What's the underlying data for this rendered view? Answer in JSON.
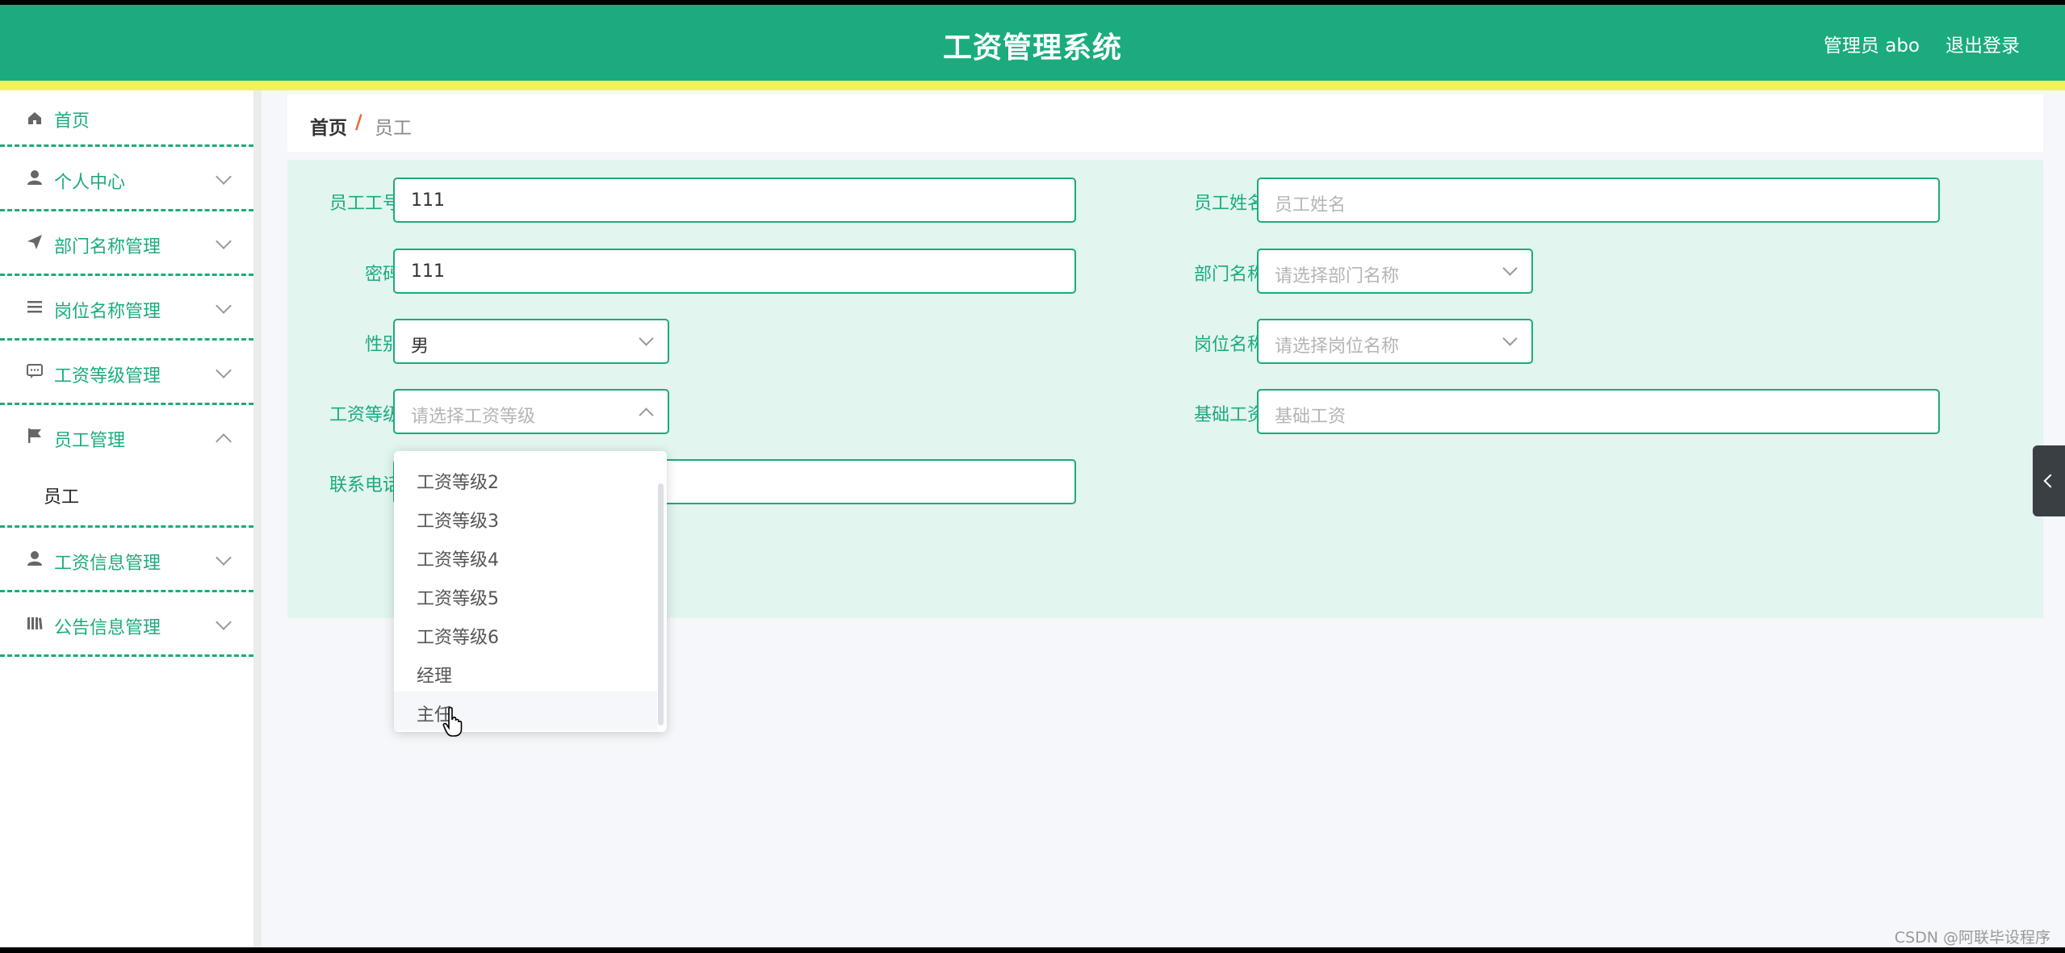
{
  "header": {
    "title": "工资管理系统",
    "user": "管理员 abo",
    "logout": "退出登录"
  },
  "sidebar": {
    "items": [
      {
        "label": "首页",
        "icon": "home-icon"
      },
      {
        "label": "个人中心",
        "icon": "user-icon"
      },
      {
        "label": "部门名称管理",
        "icon": "send-icon"
      },
      {
        "label": "岗位名称管理",
        "icon": "list-icon"
      },
      {
        "label": "工资等级管理",
        "icon": "message-icon"
      },
      {
        "label": "员工管理",
        "icon": "flag-icon",
        "expanded": true,
        "children": [
          {
            "label": "员工"
          }
        ]
      },
      {
        "label": "工资信息管理",
        "icon": "user-icon"
      },
      {
        "label": "公告信息管理",
        "icon": "library-icon"
      }
    ]
  },
  "breadcrumb": {
    "home": "首页",
    "separator": "/",
    "current": "员工"
  },
  "form": {
    "employee_no": {
      "label": "员工工号",
      "value": "111"
    },
    "employee_name": {
      "label": "员工姓名",
      "placeholder": "员工姓名"
    },
    "password": {
      "label": "密码",
      "value": "111"
    },
    "department": {
      "label": "部门名称",
      "placeholder": "请选择部门名称"
    },
    "gender": {
      "label": "性别",
      "value": "男"
    },
    "position": {
      "label": "岗位名称",
      "placeholder": "请选择岗位名称"
    },
    "salary_grade": {
      "label": "工资等级",
      "placeholder": "请选择工资等级",
      "open": true
    },
    "base_salary": {
      "label": "基础工资",
      "placeholder": "基础工资"
    },
    "phone": {
      "label": "联系电话"
    }
  },
  "dropdown": {
    "options": [
      "工资等级2",
      "工资等级3",
      "工资等级4",
      "工资等级5",
      "工资等级6",
      "经理",
      "主任"
    ],
    "hovered": "主任"
  },
  "watermark": "CSDN @阿联毕设程序",
  "colors": {
    "primary": "#1bab7e",
    "stripe": "#eef35a",
    "panel": "#e2f5ef"
  }
}
